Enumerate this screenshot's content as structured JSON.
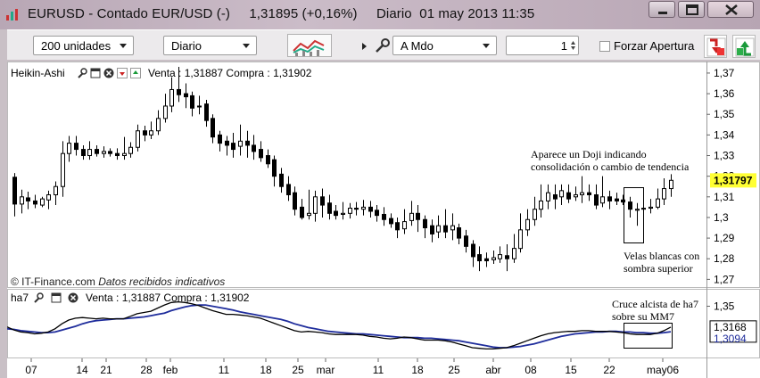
{
  "window": {
    "title": "EURUSD - Contado EUR/USD (-)     1,31895 (+0,16%)     Diario  01 may 2013 11:35"
  },
  "toolbar": {
    "units_value": "200 unidades",
    "period_value": "Diario",
    "order_mode_value": "A Mdo",
    "quantity_value": "1",
    "forzar_label": "Forzar Apertura"
  },
  "main_chart": {
    "indicator_name": "Heikin-Ashi",
    "quote_text": "Venta : 1,31887 Compra : 1,31902",
    "price_axis_ticks": [
      "1,37",
      "1,36",
      "1,35",
      "1,34",
      "1,33",
      "1,32",
      "1,31",
      "1,3",
      "1,29",
      "1,28",
      "1,27"
    ],
    "last_price": "1,31797",
    "copyright_text": "© IT-Finance.com",
    "data_notice": "Datos recibidos indicativos",
    "annotation_doji_line1": "Aparece un Doji indicando",
    "annotation_doji_line2": "consolidación o cambio de tendencia",
    "annotation_velas_line1": "Velas blancas con",
    "annotation_velas_line2": "sombra superior"
  },
  "sub_chart": {
    "indicator_name": "ha7",
    "quote_text": "Venta : 1,31887 Compra : 1,31902",
    "axis_tick": "1,35",
    "value_ha7": "1,3168",
    "value_mm7": "1,3094",
    "annotation_line1": "Cruce alcista de ha7",
    "annotation_line2": "sobre su MM7",
    "colors": {
      "ha7": "#000000",
      "mm7": "#1f2d9c"
    }
  },
  "x_axis_labels": [
    "07",
    "14",
    "21",
    "28",
    "feb",
    "11",
    "18",
    "25",
    "mar",
    "11",
    "18",
    "25",
    "abr",
    "08",
    "15",
    "22",
    "may06"
  ],
  "chart_data": {
    "type": "candlestick",
    "title": "",
    "ylim": [
      1.268,
      1.373
    ],
    "y_ticks": [
      1.37,
      1.36,
      1.35,
      1.34,
      1.33,
      1.32,
      1.31,
      1.3,
      1.29,
      1.28,
      1.27
    ],
    "candles": [
      {
        "o": 1.3195,
        "c": 1.3065,
        "h": 1.3215,
        "l": 1.3005
      },
      {
        "o": 1.3065,
        "c": 1.31,
        "h": 1.3135,
        "l": 1.302
      },
      {
        "o": 1.3095,
        "c": 1.308,
        "h": 1.3125,
        "l": 1.304
      },
      {
        "o": 1.308,
        "c": 1.3065,
        "h": 1.311,
        "l": 1.3045
      },
      {
        "o": 1.306,
        "c": 1.309,
        "h": 1.31,
        "l": 1.305
      },
      {
        "o": 1.3085,
        "c": 1.311,
        "h": 1.313,
        "l": 1.304
      },
      {
        "o": 1.311,
        "c": 1.315,
        "h": 1.3175,
        "l": 1.306
      },
      {
        "o": 1.315,
        "c": 1.331,
        "h": 1.337,
        "l": 1.31
      },
      {
        "o": 1.331,
        "c": 1.336,
        "h": 1.3395,
        "l": 1.327
      },
      {
        "o": 1.336,
        "c": 1.333,
        "h": 1.3395,
        "l": 1.33
      },
      {
        "o": 1.333,
        "c": 1.33,
        "h": 1.335,
        "l": 1.328
      },
      {
        "o": 1.33,
        "c": 1.333,
        "h": 1.337,
        "l": 1.328
      },
      {
        "o": 1.333,
        "c": 1.331,
        "h": 1.335,
        "l": 1.3295
      },
      {
        "o": 1.331,
        "c": 1.332,
        "h": 1.3345,
        "l": 1.329
      },
      {
        "o": 1.332,
        "c": 1.331,
        "h": 1.3335,
        "l": 1.3295
      },
      {
        "o": 1.331,
        "c": 1.33,
        "h": 1.3335,
        "l": 1.328
      },
      {
        "o": 1.33,
        "c": 1.331,
        "h": 1.339,
        "l": 1.328
      },
      {
        "o": 1.331,
        "c": 1.334,
        "h": 1.3365,
        "l": 1.329
      },
      {
        "o": 1.334,
        "c": 1.342,
        "h": 1.345,
        "l": 1.332
      },
      {
        "o": 1.342,
        "c": 1.34,
        "h": 1.3445,
        "l": 1.337
      },
      {
        "o": 1.34,
        "c": 1.342,
        "h": 1.3465,
        "l": 1.338
      },
      {
        "o": 1.342,
        "c": 1.348,
        "h": 1.352,
        "l": 1.34
      },
      {
        "o": 1.348,
        "c": 1.354,
        "h": 1.36,
        "l": 1.346
      },
      {
        "o": 1.354,
        "c": 1.362,
        "h": 1.368,
        "l": 1.351
      },
      {
        "o": 1.362,
        "c": 1.3595,
        "h": 1.373,
        "l": 1.356
      },
      {
        "o": 1.36,
        "c": 1.3585,
        "h": 1.365,
        "l": 1.353
      },
      {
        "o": 1.359,
        "c": 1.353,
        "h": 1.361,
        "l": 1.349
      },
      {
        "o": 1.354,
        "c": 1.354,
        "h": 1.359,
        "l": 1.35
      },
      {
        "o": 1.355,
        "c": 1.347,
        "h": 1.357,
        "l": 1.344
      },
      {
        "o": 1.348,
        "c": 1.339,
        "h": 1.35,
        "l": 1.336
      },
      {
        "o": 1.34,
        "c": 1.336,
        "h": 1.342,
        "l": 1.332
      },
      {
        "o": 1.337,
        "c": 1.335,
        "h": 1.3395,
        "l": 1.33
      },
      {
        "o": 1.336,
        "c": 1.333,
        "h": 1.341,
        "l": 1.329
      },
      {
        "o": 1.3345,
        "c": 1.337,
        "h": 1.345,
        "l": 1.33
      },
      {
        "o": 1.337,
        "c": 1.335,
        "h": 1.342,
        "l": 1.329
      },
      {
        "o": 1.335,
        "c": 1.332,
        "h": 1.34,
        "l": 1.328
      },
      {
        "o": 1.333,
        "c": 1.329,
        "h": 1.337,
        "l": 1.327
      },
      {
        "o": 1.33,
        "c": 1.326,
        "h": 1.333,
        "l": 1.324
      },
      {
        "o": 1.328,
        "c": 1.32,
        "h": 1.33,
        "l": 1.315
      },
      {
        "o": 1.321,
        "c": 1.315,
        "h": 1.324,
        "l": 1.312
      },
      {
        "o": 1.316,
        "c": 1.311,
        "h": 1.32,
        "l": 1.308
      },
      {
        "o": 1.312,
        "c": 1.304,
        "h": 1.315,
        "l": 1.301
      },
      {
        "o": 1.305,
        "c": 1.3,
        "h": 1.309,
        "l": 1.299
      },
      {
        "o": 1.301,
        "c": 1.302,
        "h": 1.3135,
        "l": 1.299
      },
      {
        "o": 1.302,
        "c": 1.31,
        "h": 1.313,
        "l": 1.298
      },
      {
        "o": 1.31,
        "c": 1.306,
        "h": 1.314,
        "l": 1.3
      },
      {
        "o": 1.307,
        "c": 1.302,
        "h": 1.311,
        "l": 1.299
      },
      {
        "o": 1.303,
        "c": 1.301,
        "h": 1.306,
        "l": 1.299
      },
      {
        "o": 1.3015,
        "c": 1.302,
        "h": 1.3075,
        "l": 1.299
      },
      {
        "o": 1.302,
        "c": 1.3045,
        "h": 1.307,
        "l": 1.2995
      },
      {
        "o": 1.3045,
        "c": 1.304,
        "h": 1.3075,
        "l": 1.301
      },
      {
        "o": 1.304,
        "c": 1.305,
        "h": 1.3085,
        "l": 1.301
      },
      {
        "o": 1.305,
        "c": 1.303,
        "h": 1.308,
        "l": 1.3
      },
      {
        "o": 1.3035,
        "c": 1.301,
        "h": 1.306,
        "l": 1.298
      },
      {
        "o": 1.3015,
        "c": 1.299,
        "h": 1.305,
        "l": 1.296
      },
      {
        "o": 1.2995,
        "c": 1.297,
        "h": 1.302,
        "l": 1.295
      },
      {
        "o": 1.2975,
        "c": 1.294,
        "h": 1.3,
        "l": 1.29
      },
      {
        "o": 1.2945,
        "c": 1.298,
        "h": 1.304,
        "l": 1.292
      },
      {
        "o": 1.2985,
        "c": 1.302,
        "h": 1.308,
        "l": 1.296
      },
      {
        "o": 1.302,
        "c": 1.299,
        "h": 1.306,
        "l": 1.293
      },
      {
        "o": 1.299,
        "c": 1.295,
        "h": 1.301,
        "l": 1.29
      },
      {
        "o": 1.296,
        "c": 1.292,
        "h": 1.299,
        "l": 1.288
      },
      {
        "o": 1.293,
        "c": 1.296,
        "h": 1.301,
        "l": 1.29
      },
      {
        "o": 1.296,
        "c": 1.293,
        "h": 1.304,
        "l": 1.29
      },
      {
        "o": 1.294,
        "c": 1.296,
        "h": 1.302,
        "l": 1.289
      },
      {
        "o": 1.295,
        "c": 1.29,
        "h": 1.297,
        "l": 1.287
      },
      {
        "o": 1.291,
        "c": 1.286,
        "h": 1.294,
        "l": 1.283
      },
      {
        "o": 1.287,
        "c": 1.281,
        "h": 1.289,
        "l": 1.276
      },
      {
        "o": 1.282,
        "c": 1.279,
        "h": 1.286,
        "l": 1.274
      },
      {
        "o": 1.28,
        "c": 1.279,
        "h": 1.283,
        "l": 1.276
      },
      {
        "o": 1.2795,
        "c": 1.2805,
        "h": 1.284,
        "l": 1.2775
      },
      {
        "o": 1.28,
        "c": 1.282,
        "h": 1.286,
        "l": 1.278
      },
      {
        "o": 1.2815,
        "c": 1.28,
        "h": 1.287,
        "l": 1.274
      },
      {
        "o": 1.28,
        "c": 1.285,
        "h": 1.292,
        "l": 1.278
      },
      {
        "o": 1.285,
        "c": 1.294,
        "h": 1.302,
        "l": 1.283
      },
      {
        "o": 1.294,
        "c": 1.299,
        "h": 1.304,
        "l": 1.291
      },
      {
        "o": 1.299,
        "c": 1.304,
        "h": 1.31,
        "l": 1.296
      },
      {
        "o": 1.304,
        "c": 1.308,
        "h": 1.316,
        "l": 1.3
      },
      {
        "o": 1.308,
        "c": 1.312,
        "h": 1.316,
        "l": 1.304
      },
      {
        "o": 1.311,
        "c": 1.309,
        "h": 1.316,
        "l": 1.304
      },
      {
        "o": 1.31,
        "c": 1.313,
        "h": 1.316,
        "l": 1.306
      },
      {
        "o": 1.312,
        "c": 1.309,
        "h": 1.316,
        "l": 1.307
      },
      {
        "o": 1.31,
        "c": 1.311,
        "h": 1.315,
        "l": 1.308
      },
      {
        "o": 1.311,
        "c": 1.312,
        "h": 1.32,
        "l": 1.307
      },
      {
        "o": 1.312,
        "c": 1.311,
        "h": 1.316,
        "l": 1.308
      },
      {
        "o": 1.311,
        "c": 1.306,
        "h": 1.316,
        "l": 1.304
      },
      {
        "o": 1.307,
        "c": 1.31,
        "h": 1.32,
        "l": 1.305
      },
      {
        "o": 1.31,
        "c": 1.308,
        "h": 1.313,
        "l": 1.304
      },
      {
        "o": 1.309,
        "c": 1.308,
        "h": 1.312,
        "l": 1.306
      },
      {
        "o": 1.3085,
        "c": 1.3075,
        "h": 1.311,
        "l": 1.306
      },
      {
        "o": 1.3075,
        "c": 1.304,
        "h": 1.31,
        "l": 1.3
      },
      {
        "o": 1.3035,
        "c": 1.304,
        "h": 1.307,
        "l": 1.296
      },
      {
        "o": 1.304,
        "c": 1.3045,
        "h": 1.308,
        "l": 1.301
      },
      {
        "o": 1.3045,
        "c": 1.305,
        "h": 1.309,
        "l": 1.302
      },
      {
        "o": 1.305,
        "c": 1.309,
        "h": 1.314,
        "l": 1.304
      },
      {
        "o": 1.309,
        "c": 1.314,
        "h": 1.319,
        "l": 1.306
      },
      {
        "o": 1.314,
        "c": 1.318,
        "h": 1.321,
        "l": 1.31
      }
    ],
    "ha7_series": [
      1.317,
      1.312,
      1.309,
      1.308,
      1.306,
      1.307,
      1.309,
      1.314,
      1.322,
      1.328,
      1.331,
      1.332,
      1.331,
      1.33,
      1.331,
      1.33,
      1.33,
      1.33,
      1.334,
      1.338,
      1.34,
      1.342,
      1.347,
      1.352,
      1.356,
      1.357,
      1.356,
      1.354,
      1.351,
      1.347,
      1.343,
      1.34,
      1.337,
      1.337,
      1.336,
      1.335,
      1.333,
      1.331,
      1.327,
      1.323,
      1.319,
      1.315,
      1.311,
      1.309,
      1.31,
      1.309,
      1.308,
      1.306,
      1.305,
      1.305,
      1.305,
      1.305,
      1.304,
      1.302,
      1.301,
      1.299,
      1.298,
      1.299,
      1.301,
      1.3,
      1.298,
      1.296,
      1.296,
      1.296,
      1.295,
      1.293,
      1.29,
      1.287,
      1.284,
      1.283,
      1.282,
      1.282,
      1.283,
      1.284,
      1.287,
      1.291,
      1.295,
      1.299,
      1.303,
      1.306,
      1.308,
      1.309,
      1.31,
      1.31,
      1.311,
      1.311,
      1.31,
      1.31,
      1.31,
      1.309,
      1.308,
      1.306,
      1.305,
      1.305,
      1.305,
      1.307,
      1.311,
      1.3168
    ],
    "mm7_series": [
      1.314,
      1.313,
      1.311,
      1.31,
      1.309,
      1.308,
      1.308,
      1.309,
      1.312,
      1.315,
      1.318,
      1.322,
      1.325,
      1.327,
      1.328,
      1.329,
      1.33,
      1.33,
      1.331,
      1.332,
      1.333,
      1.335,
      1.337,
      1.339,
      1.343,
      1.346,
      1.349,
      1.351,
      1.352,
      1.352,
      1.35,
      1.348,
      1.346,
      1.344,
      1.341,
      1.339,
      1.337,
      1.335,
      1.333,
      1.331,
      1.329,
      1.326,
      1.322,
      1.319,
      1.316,
      1.314,
      1.312,
      1.31,
      1.309,
      1.308,
      1.307,
      1.306,
      1.306,
      1.305,
      1.304,
      1.303,
      1.302,
      1.301,
      1.3,
      1.3,
      1.3,
      1.299,
      1.299,
      1.298,
      1.297,
      1.296,
      1.295,
      1.293,
      1.291,
      1.289,
      1.287,
      1.285,
      1.284,
      1.284,
      1.285,
      1.286,
      1.288,
      1.29,
      1.293,
      1.296,
      1.299,
      1.302,
      1.304,
      1.306,
      1.307,
      1.308,
      1.309,
      1.309,
      1.31,
      1.31,
      1.309,
      1.309,
      1.308,
      1.308,
      1.307,
      1.307,
      1.308,
      1.3094
    ],
    "sub_ylim": [
      1.274,
      1.372
    ]
  }
}
